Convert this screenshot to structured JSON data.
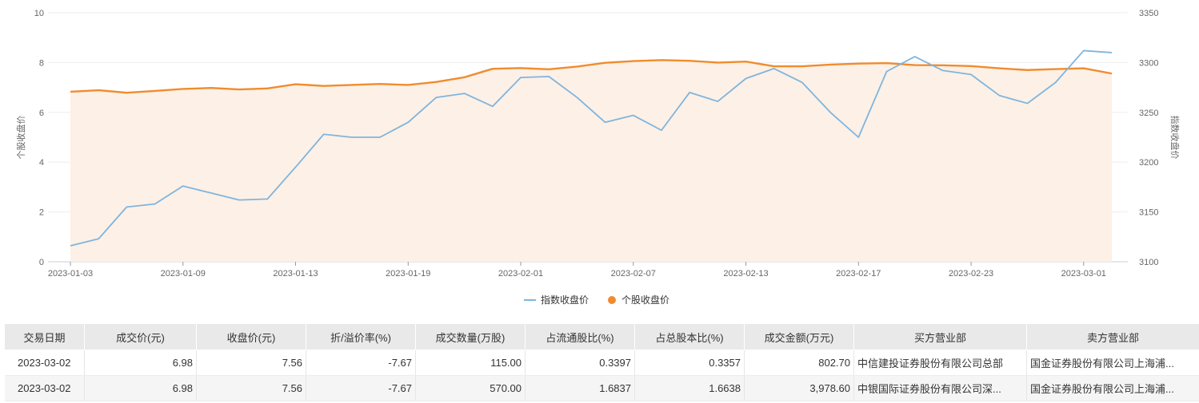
{
  "chart_data": {
    "type": "line",
    "dates": [
      "2023-01-03",
      "2023-01-04",
      "2023-01-05",
      "2023-01-06",
      "2023-01-09",
      "2023-01-10",
      "2023-01-11",
      "2023-01-12",
      "2023-01-13",
      "2023-01-16",
      "2023-01-17",
      "2023-01-18",
      "2023-01-19",
      "2023-01-20",
      "2023-01-30",
      "2023-01-31",
      "2023-02-01",
      "2023-02-02",
      "2023-02-03",
      "2023-02-06",
      "2023-02-07",
      "2023-02-08",
      "2023-02-09",
      "2023-02-10",
      "2023-02-13",
      "2023-02-14",
      "2023-02-15",
      "2023-02-16",
      "2023-02-17",
      "2023-02-20",
      "2023-02-21",
      "2023-02-22",
      "2023-02-23",
      "2023-02-24",
      "2023-02-27",
      "2023-02-28",
      "2023-03-01",
      "2023-03-02"
    ],
    "x_tick_labels": [
      "2023-01-03",
      "2023-01-09",
      "2023-01-13",
      "2023-01-19",
      "2023-02-01",
      "2023-02-07",
      "2023-02-13",
      "2023-02-17",
      "2023-02-23",
      "2023-03-01"
    ],
    "y_left": {
      "label": "个股收盘价",
      "min": 0,
      "max": 10,
      "ticks": [
        "0",
        "2",
        "4",
        "6",
        "8",
        "10"
      ]
    },
    "y_right": {
      "label": "指数收盘价",
      "min": 3100,
      "max": 3350,
      "ticks": [
        "3100",
        "3150",
        "3200",
        "3250",
        "3300",
        "3350"
      ]
    },
    "series": [
      {
        "name": "指数收盘价",
        "axis": "right",
        "color": "#7eb5de",
        "style": "line",
        "values": [
          3116,
          3123,
          3155,
          3158,
          3176,
          3169,
          3162,
          3163,
          3195,
          3228,
          3225,
          3225,
          3240,
          3265,
          3269,
          3256,
          3285,
          3286,
          3265,
          3240,
          3247,
          3232,
          3270,
          3261,
          3284,
          3294,
          3280,
          3250,
          3225,
          3291,
          3306,
          3292,
          3288,
          3267,
          3259,
          3280,
          3312,
          3310
        ]
      },
      {
        "name": "个股收盘价",
        "axis": "left",
        "color": "#f08c2e",
        "style": "area",
        "area_color": "#fdf0e6",
        "values": [
          6.83,
          6.89,
          6.79,
          6.86,
          6.94,
          6.98,
          6.92,
          6.96,
          7.13,
          7.06,
          7.1,
          7.14,
          7.1,
          7.22,
          7.41,
          7.75,
          7.78,
          7.73,
          7.84,
          7.99,
          8.06,
          8.1,
          8.07,
          8.0,
          8.04,
          7.85,
          7.85,
          7.92,
          7.96,
          7.98,
          7.9,
          7.89,
          7.86,
          7.77,
          7.7,
          7.74,
          7.77,
          7.56
        ]
      }
    ],
    "legend_position": "bottom-center",
    "grid": true
  },
  "table": {
    "headers": [
      "交易日期",
      "成交价(元)",
      "收盘价(元)",
      "折/溢价率(%)",
      "成交数量(万股)",
      "占流通股比(%)",
      "占总股本比(%)",
      "成交金额(万元)",
      "买方营业部",
      "卖方营业部"
    ],
    "rows": [
      [
        "2023-03-02",
        "6.98",
        "7.56",
        "-7.67",
        "115.00",
        "0.3397",
        "0.3357",
        "802.70",
        "中信建投证券股份有限公司总部",
        "国金证券股份有限公司上海浦..."
      ],
      [
        "2023-03-02",
        "6.98",
        "7.56",
        "-7.67",
        "570.00",
        "1.6837",
        "1.6638",
        "3,978.60",
        "中银国际证券股份有限公司深...",
        "国金证券股份有限公司上海浦..."
      ]
    ]
  }
}
